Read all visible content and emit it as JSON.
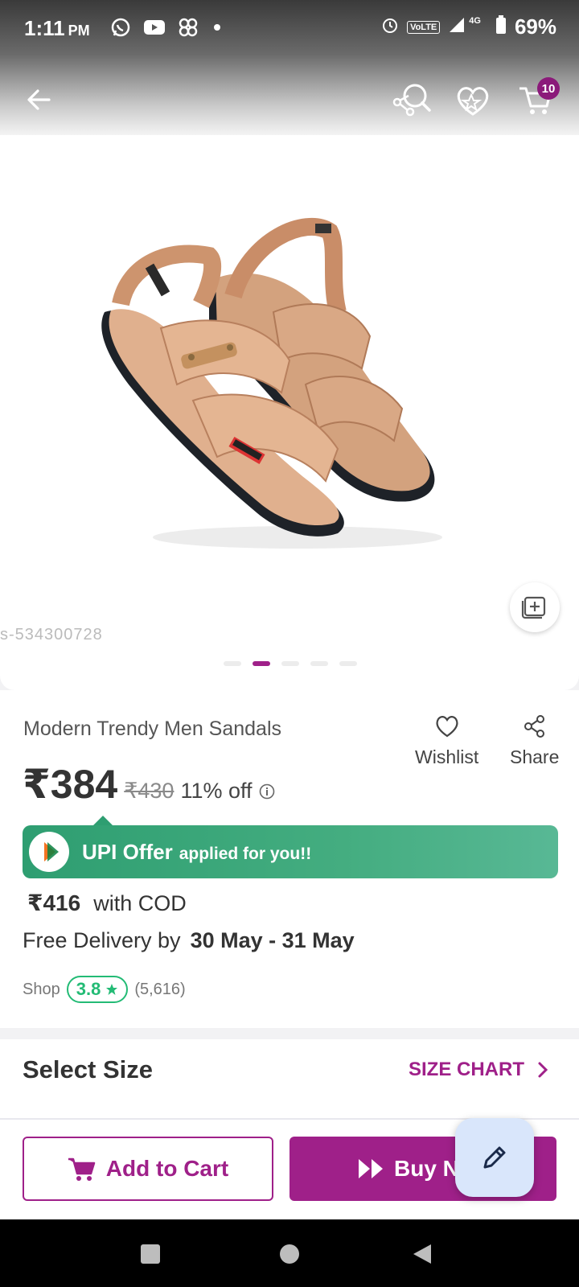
{
  "status_bar": {
    "time": "1:11",
    "ampm": "PM",
    "network": "4G",
    "volte": "VoLTE",
    "battery": "69%",
    "icons_left": [
      "whatsapp-icon",
      "youtube-icon",
      "pinwheel-icon",
      "dot-icon"
    ],
    "icons_right": [
      "alarm-icon",
      "volte-icon",
      "signal-icon",
      "battery-icon"
    ]
  },
  "toolbar": {
    "back_icon": "back-arrow-icon",
    "search_icon": "share-search-icon",
    "wishlist_icon": "heart-star-icon",
    "cart_icon": "cart-icon",
    "cart_count": "10"
  },
  "gallery": {
    "sku": "s-534300728",
    "image_count": 5,
    "active_index": 1
  },
  "product": {
    "title": "Modern Trendy Men Sandals",
    "price": "₹384",
    "mrp": "₹430",
    "discount": "11% off",
    "wishlist_label": "Wishlist",
    "share_label": "Share"
  },
  "upi_offer": {
    "title": "UPI Offer",
    "subtitle": "applied for you!!"
  },
  "cod": {
    "price": "₹416",
    "label": "with COD"
  },
  "delivery": {
    "label": "Free Delivery by",
    "date": "30 May - 31 May"
  },
  "shop": {
    "label": "Shop",
    "rating": "3.8",
    "count": "(5,616)"
  },
  "size": {
    "title": "Select Size",
    "chart_label": "SIZE CHART"
  },
  "actions": {
    "add_to_cart": "Add to Cart",
    "buy_now": "Buy N"
  },
  "colors": {
    "brand": "#9f2089",
    "upi_green": "#2e9e71",
    "rating_green": "#23bb75",
    "fab_bg": "#d9e6fb"
  }
}
